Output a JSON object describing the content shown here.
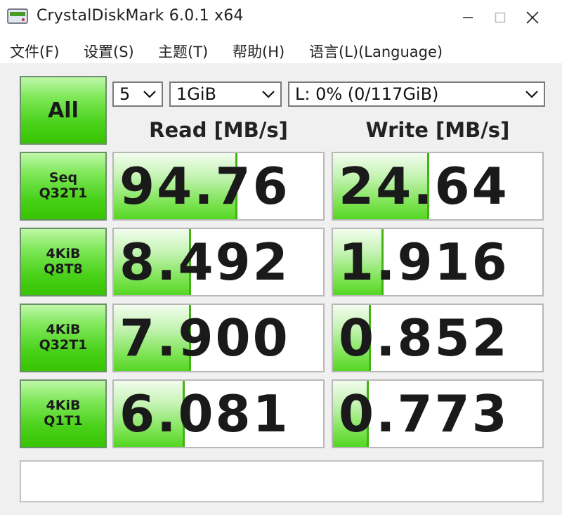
{
  "window": {
    "title": "CrystalDiskMark 6.0.1 x64",
    "minimize_icon": "minimize-icon",
    "maximize_icon": "maximize-icon",
    "close_icon": "close-icon"
  },
  "menu": {
    "items": [
      "文件(F)",
      "设置(S)",
      "主题(T)",
      "帮助(H)",
      "语言(L)(Language)"
    ]
  },
  "controls": {
    "all_label": "All",
    "count_value": "5",
    "size_value": "1GiB",
    "drive_value": "L: 0% (0/117GiB)"
  },
  "headers": {
    "read": "Read [MB/s]",
    "write": "Write [MB/s]"
  },
  "tests": [
    {
      "line1": "Seq",
      "line2": "Q32T1",
      "read": "94.76",
      "write": "24.64",
      "read_fill": 0.59,
      "write_fill": 0.46
    },
    {
      "line1": "4KiB",
      "line2": "Q8T8",
      "read": "8.492",
      "write": "1.916",
      "read_fill": 0.37,
      "write_fill": 0.24
    },
    {
      "line1": "4KiB",
      "line2": "Q32T1",
      "read": "7.900",
      "write": "0.852",
      "read_fill": 0.37,
      "write_fill": 0.18
    },
    {
      "line1": "4KiB",
      "line2": "Q1T1",
      "read": "6.081",
      "write": "0.773",
      "read_fill": 0.34,
      "write_fill": 0.17
    }
  ],
  "comment": "",
  "colors": {
    "bar_green": "#55d622",
    "button_green": "#49d11a"
  }
}
